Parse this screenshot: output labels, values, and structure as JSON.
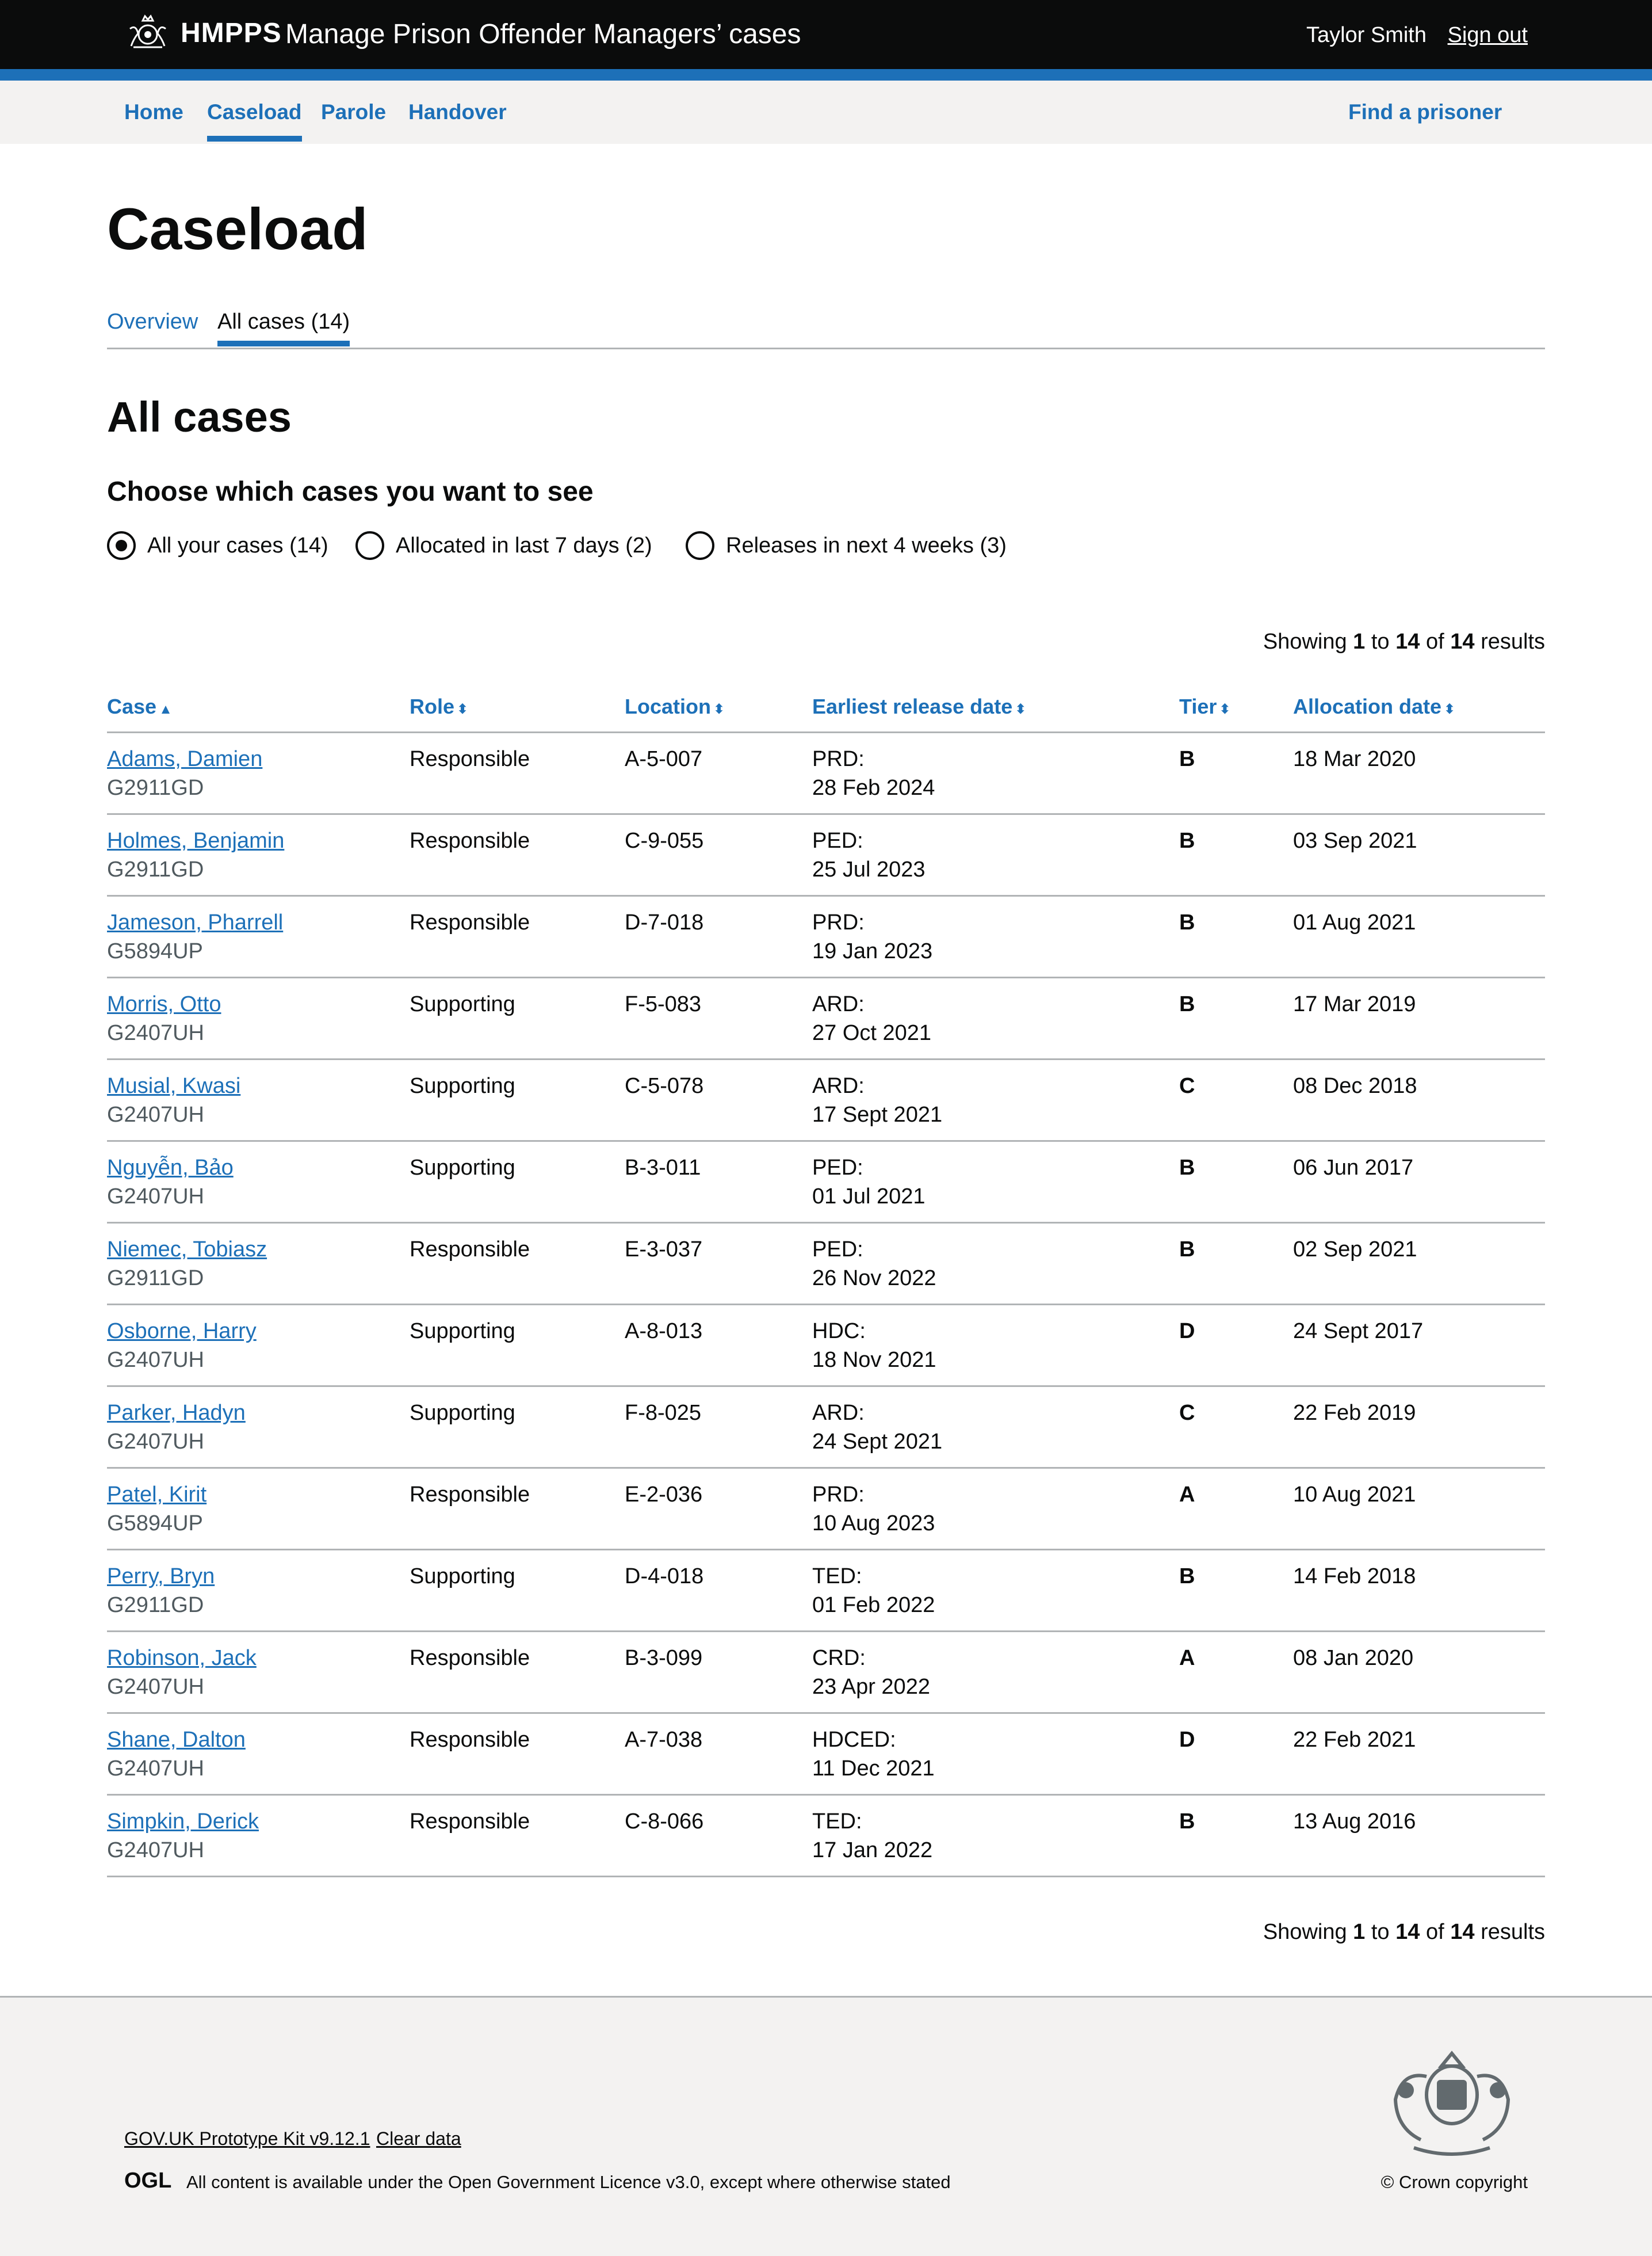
{
  "header": {
    "brand": "HMPPS",
    "service": "Manage Prison Offender Managers’ cases",
    "user_name": "Taylor Smith",
    "sign_out": "Sign out"
  },
  "primary_nav": {
    "home": "Home",
    "caseload": "Caseload",
    "parole": "Parole",
    "handover": "Handover",
    "find": "Find a prisoner"
  },
  "page": {
    "title": "Caseload",
    "tabs": {
      "overview": "Overview",
      "all_cases": "All cases (14)"
    },
    "section_title": "All cases",
    "filter_legend": "Choose which cases you want to see",
    "filters": {
      "all": "All your cases (14)",
      "recent": "Allocated in last 7 days (2)",
      "releases": "Releases in next 4 weeks (3)"
    }
  },
  "results": {
    "prefix": "Showing",
    "from": "1",
    "to_word": "to",
    "to": "14",
    "of_word": "of",
    "total": "14",
    "suffix": "results"
  },
  "table": {
    "headers": {
      "case": "Case",
      "role": "Role",
      "location": "Location",
      "release": "Earliest release date",
      "tier": "Tier",
      "allocation": "Allocation date"
    },
    "sort_glyphs": {
      "asc": "▲",
      "both": "⬍"
    },
    "rows": [
      {
        "name": "Adams, Damien",
        "id": "G2911GD",
        "role": "Responsible",
        "location": "A-5-007",
        "release_type": "PRD:",
        "release_date": "28 Feb 2024",
        "tier": "B",
        "allocation": "18 Mar 2020"
      },
      {
        "name": "Holmes, Benjamin",
        "id": "G2911GD",
        "role": "Responsible",
        "location": "C-9-055",
        "release_type": "PED:",
        "release_date": "25 Jul 2023",
        "tier": "B",
        "allocation": "03 Sep 2021"
      },
      {
        "name": "Jameson, Pharrell",
        "id": "G5894UP",
        "role": "Responsible",
        "location": "D-7-018",
        "release_type": "PRD:",
        "release_date": "19 Jan 2023",
        "tier": "B",
        "allocation": "01 Aug 2021"
      },
      {
        "name": "Morris, Otto",
        "id": "G2407UH",
        "role": "Supporting",
        "location": "F-5-083",
        "release_type": "ARD:",
        "release_date": "27 Oct 2021",
        "tier": "B",
        "allocation": "17 Mar 2019"
      },
      {
        "name": "Musial, Kwasi",
        "id": "G2407UH",
        "role": "Supporting",
        "location": "C-5-078",
        "release_type": "ARD:",
        "release_date": "17 Sept 2021",
        "tier": "C",
        "allocation": "08 Dec 2018"
      },
      {
        "name": "Nguyễn, Bảo",
        "id": "G2407UH",
        "role": "Supporting",
        "location": "B-3-011",
        "release_type": "PED:",
        "release_date": "01 Jul 2021",
        "tier": "B",
        "allocation": "06 Jun 2017"
      },
      {
        "name": "Niemec, Tobiasz",
        "id": "G2911GD",
        "role": "Responsible",
        "location": "E-3-037",
        "release_type": "PED:",
        "release_date": "26 Nov 2022",
        "tier": "B",
        "allocation": "02 Sep 2021"
      },
      {
        "name": "Osborne, Harry",
        "id": "G2407UH",
        "role": "Supporting",
        "location": "A-8-013",
        "release_type": "HDC:",
        "release_date": "18 Nov 2021",
        "tier": "D",
        "allocation": "24 Sept 2017"
      },
      {
        "name": "Parker, Hadyn",
        "id": "G2407UH",
        "role": "Supporting",
        "location": "F-8-025",
        "release_type": "ARD:",
        "release_date": "24 Sept 2021",
        "tier": "C",
        "allocation": "22 Feb 2019"
      },
      {
        "name": "Patel, Kirit",
        "id": "G5894UP",
        "role": "Responsible",
        "location": "E-2-036",
        "release_type": "PRD:",
        "release_date": "10 Aug 2023",
        "tier": "A",
        "allocation": "10 Aug 2021"
      },
      {
        "name": "Perry, Bryn",
        "id": "G2911GD",
        "role": "Supporting",
        "location": "D-4-018",
        "release_type": "TED:",
        "release_date": "01 Feb 2022",
        "tier": "B",
        "allocation": "14 Feb 2018"
      },
      {
        "name": "Robinson, Jack",
        "id": "G2407UH",
        "role": "Responsible",
        "location": "B-3-099",
        "release_type": "CRD:",
        "release_date": "23 Apr 2022",
        "tier": "A",
        "allocation": "08 Jan 2020"
      },
      {
        "name": "Shane, Dalton",
        "id": "G2407UH",
        "role": "Responsible",
        "location": "A-7-038",
        "release_type": "HDCED:",
        "release_date": "11 Dec 2021",
        "tier": "D",
        "allocation": "22 Feb 2021"
      },
      {
        "name": "Simpkin, Derick",
        "id": "G2407UH",
        "role": "Responsible",
        "location": "C-8-066",
        "release_type": "TED:",
        "release_date": "17 Jan 2022",
        "tier": "B",
        "allocation": "13 Aug 2016"
      }
    ]
  },
  "footer": {
    "kit": "GOV.UK Prototype Kit v9.12.1",
    "clear": "Clear data",
    "ogl": "OGL",
    "licence_before": "All content is available under the ",
    "licence_link": "Open Government Licence v3.0",
    "licence_after": ", except where otherwise stated",
    "copyright": "© Crown copyright"
  },
  "colors": {
    "link": "#1d70b8",
    "header": "#0b0c0c",
    "footer_bg": "#f3f2f1",
    "border": "#b1b4b6"
  }
}
